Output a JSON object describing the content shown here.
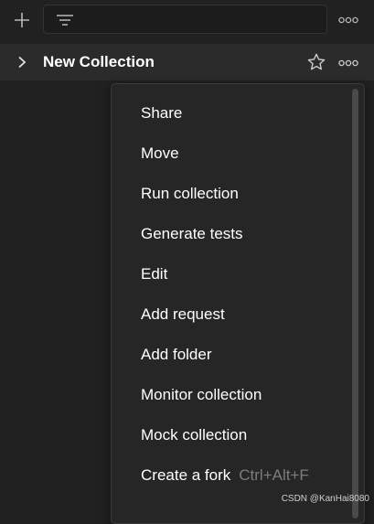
{
  "toolbar": {
    "add_icon": "plus-icon",
    "filter_icon": "filter-icon",
    "more_icon": "more-horizontal-icon"
  },
  "collection": {
    "chevron_icon": "chevron-right-icon",
    "name": "New Collection",
    "star_icon": "star-outline-icon",
    "more_icon": "more-horizontal-icon"
  },
  "menu": {
    "items": [
      {
        "label": "Share",
        "shortcut": ""
      },
      {
        "label": "Move",
        "shortcut": ""
      },
      {
        "label": "Run collection",
        "shortcut": ""
      },
      {
        "label": "Generate tests",
        "shortcut": ""
      },
      {
        "label": "Edit",
        "shortcut": ""
      },
      {
        "label": "Add request",
        "shortcut": ""
      },
      {
        "label": "Add folder",
        "shortcut": ""
      },
      {
        "label": "Monitor collection",
        "shortcut": ""
      },
      {
        "label": "Mock collection",
        "shortcut": ""
      },
      {
        "label": "Create a fork",
        "shortcut": "Ctrl+Alt+F"
      }
    ]
  },
  "watermark": "CSDN @KanHai8080",
  "colors": {
    "background": "#212121",
    "row_background": "#2b2b2b",
    "menu_background": "#262626",
    "text": "#ffffff",
    "shortcut_text": "#7d7d7d"
  }
}
